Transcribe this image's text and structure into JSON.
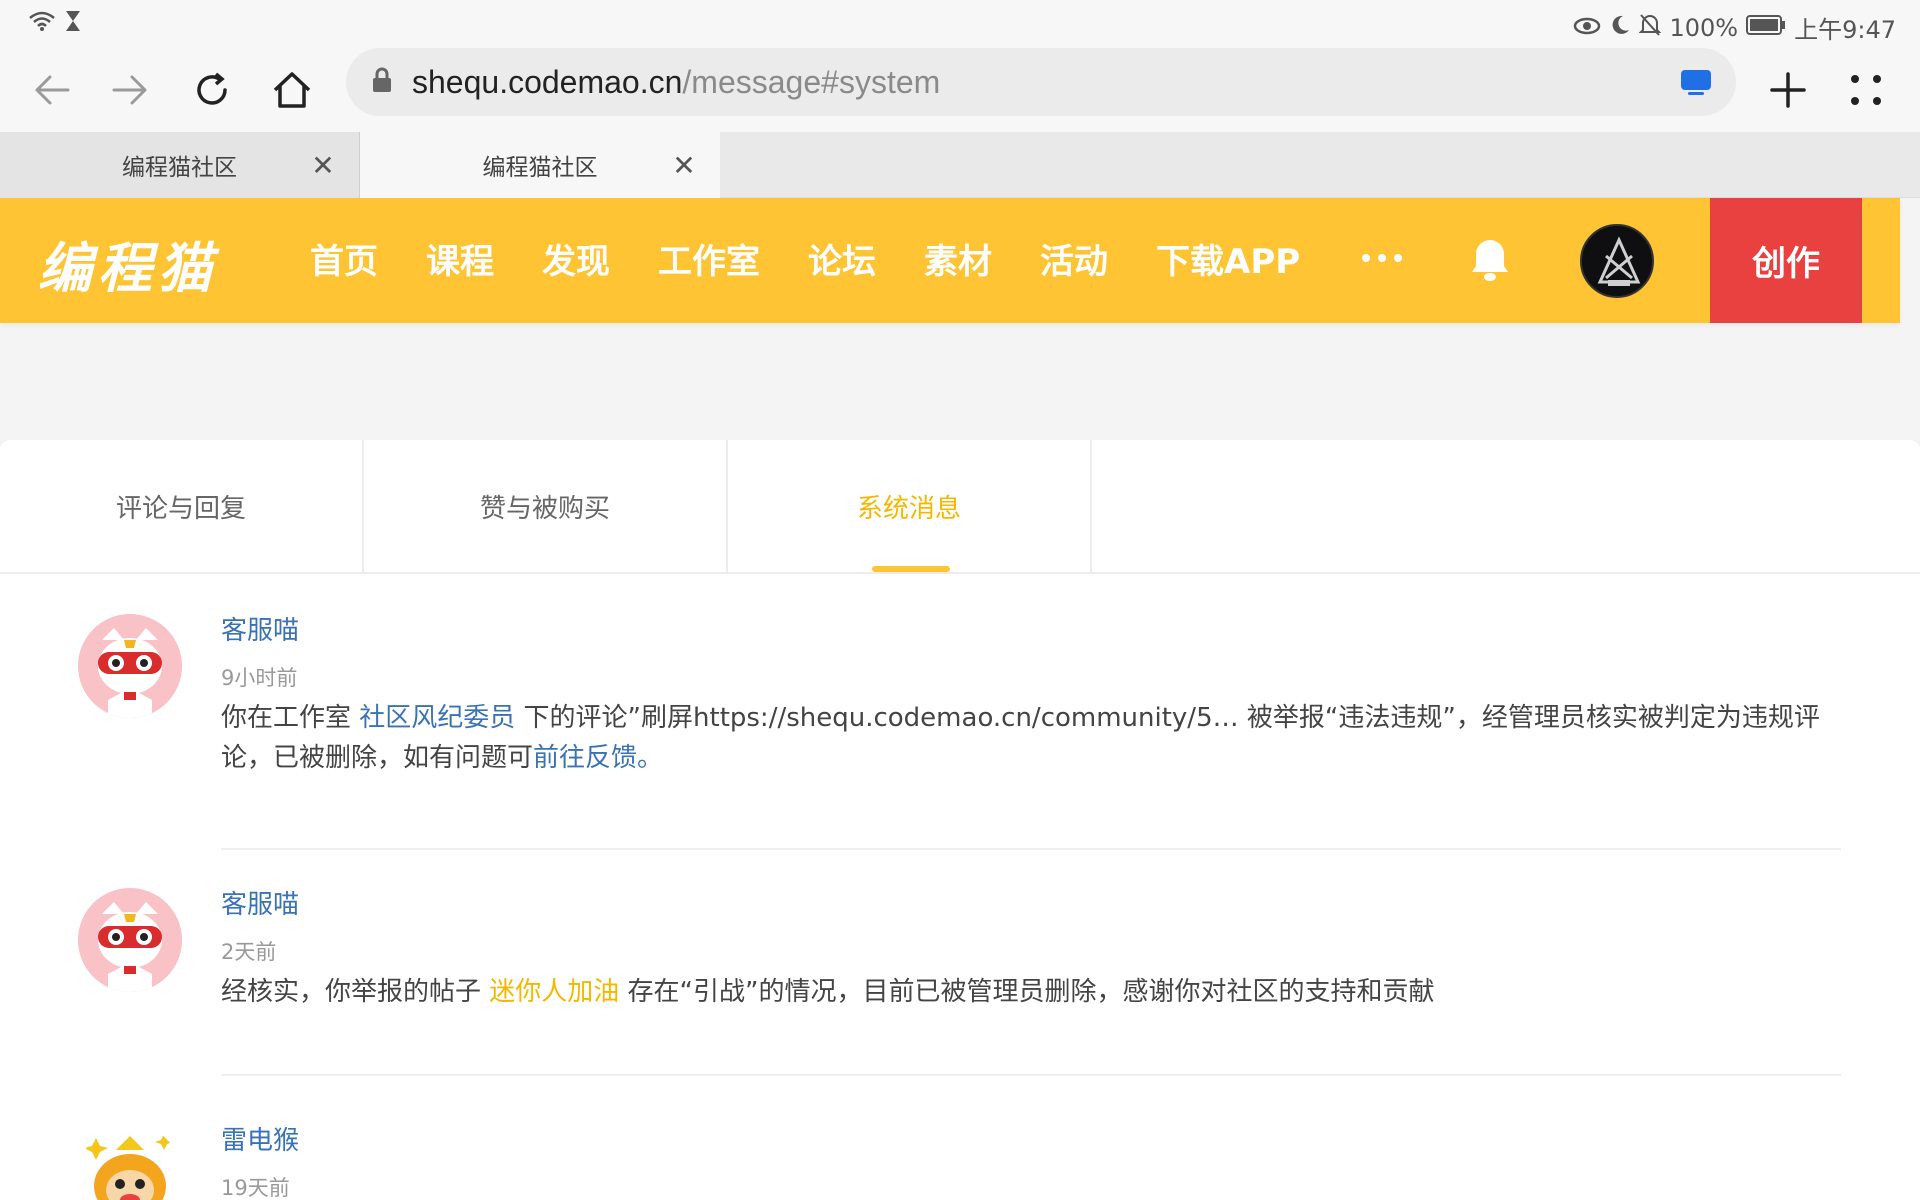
{
  "status_bar": {
    "battery": "100%",
    "time": "上午9:47"
  },
  "browser": {
    "url_host": "shequ.codemao.cn",
    "url_path": "/message#system",
    "tabs": [
      {
        "title": "编程猫社区"
      },
      {
        "title": "编程猫社区"
      }
    ]
  },
  "site": {
    "logo": "编程猫",
    "nav": [
      "首页",
      "课程",
      "发现",
      "工作室",
      "论坛",
      "素材",
      "活动",
      "下载APP"
    ],
    "create_label": "创作",
    "colors": {
      "brand": "#fec433",
      "create": "#e94040",
      "link": "#3a73b5",
      "accent": "#f5b800"
    }
  },
  "message_tabs": [
    {
      "label": "评论与回复"
    },
    {
      "label": "赞与被购买"
    },
    {
      "label": "系统消息",
      "active": true
    }
  ],
  "messages": [
    {
      "sender": "客服喵",
      "time": "9小时前",
      "text_1": "你在工作室 ",
      "link_1": "社区风纪委员",
      "text_2": " 下的评论”刷屏https://shequ.codemao.cn/community/5… 被举报“违法违规”，经管理员核实被判定为违规评论，已被删除，如有问题可",
      "link_2": "前往反馈",
      "text_3": "。"
    },
    {
      "sender": "客服喵",
      "time": "2天前",
      "text_1": "经核实，你举报的帖子 ",
      "link_1": "迷你人加油",
      "text_2": " 存在“引战”的情况，目前已被管理员删除，感谢你对社区的支持和贡献"
    },
    {
      "sender": "雷电猴",
      "time": "19天前"
    }
  ]
}
